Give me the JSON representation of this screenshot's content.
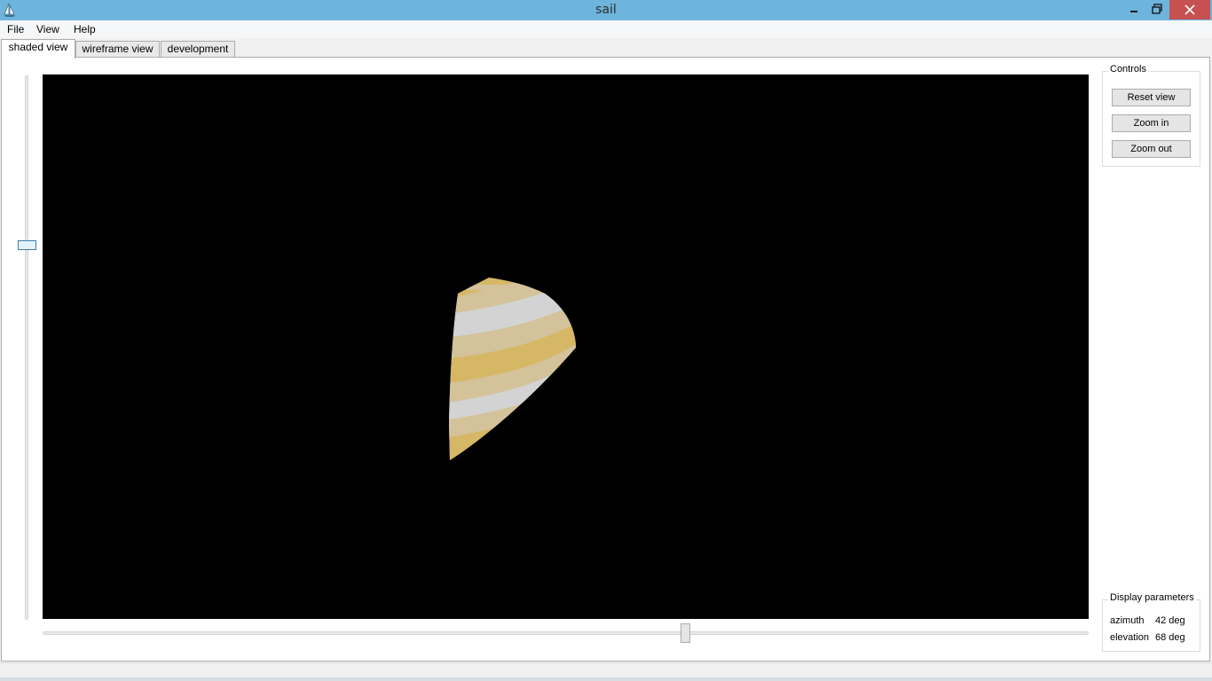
{
  "window": {
    "title": "sail",
    "minimize_icon": "minimize-icon",
    "maximize_icon": "restore-icon",
    "close_icon": "close-icon",
    "titlebar_color": "#6db5dc"
  },
  "menu": {
    "file": "File",
    "view": "View",
    "help": "Help"
  },
  "tabs": [
    {
      "label": "shaded view",
      "active": true
    },
    {
      "label": "wireframe view",
      "active": false
    },
    {
      "label": "development",
      "active": false
    }
  ],
  "viewport": {
    "background": "#000000",
    "sail_colors": {
      "gold": "#d6b765",
      "beige": "#d3c29a",
      "grey": "#d3d3d3"
    }
  },
  "controls": {
    "title": "Controls",
    "reset_view": "Reset view",
    "zoom_in": "Zoom in",
    "zoom_out": "Zoom out"
  },
  "display_parameters": {
    "title": "Display parameters",
    "azimuth_label": "azimuth",
    "azimuth_value": "42 deg",
    "elevation_label": "elevation",
    "elevation_value": "68 deg"
  },
  "sliders": {
    "vertical_position": 0.31,
    "horizontal_position": 0.61
  }
}
